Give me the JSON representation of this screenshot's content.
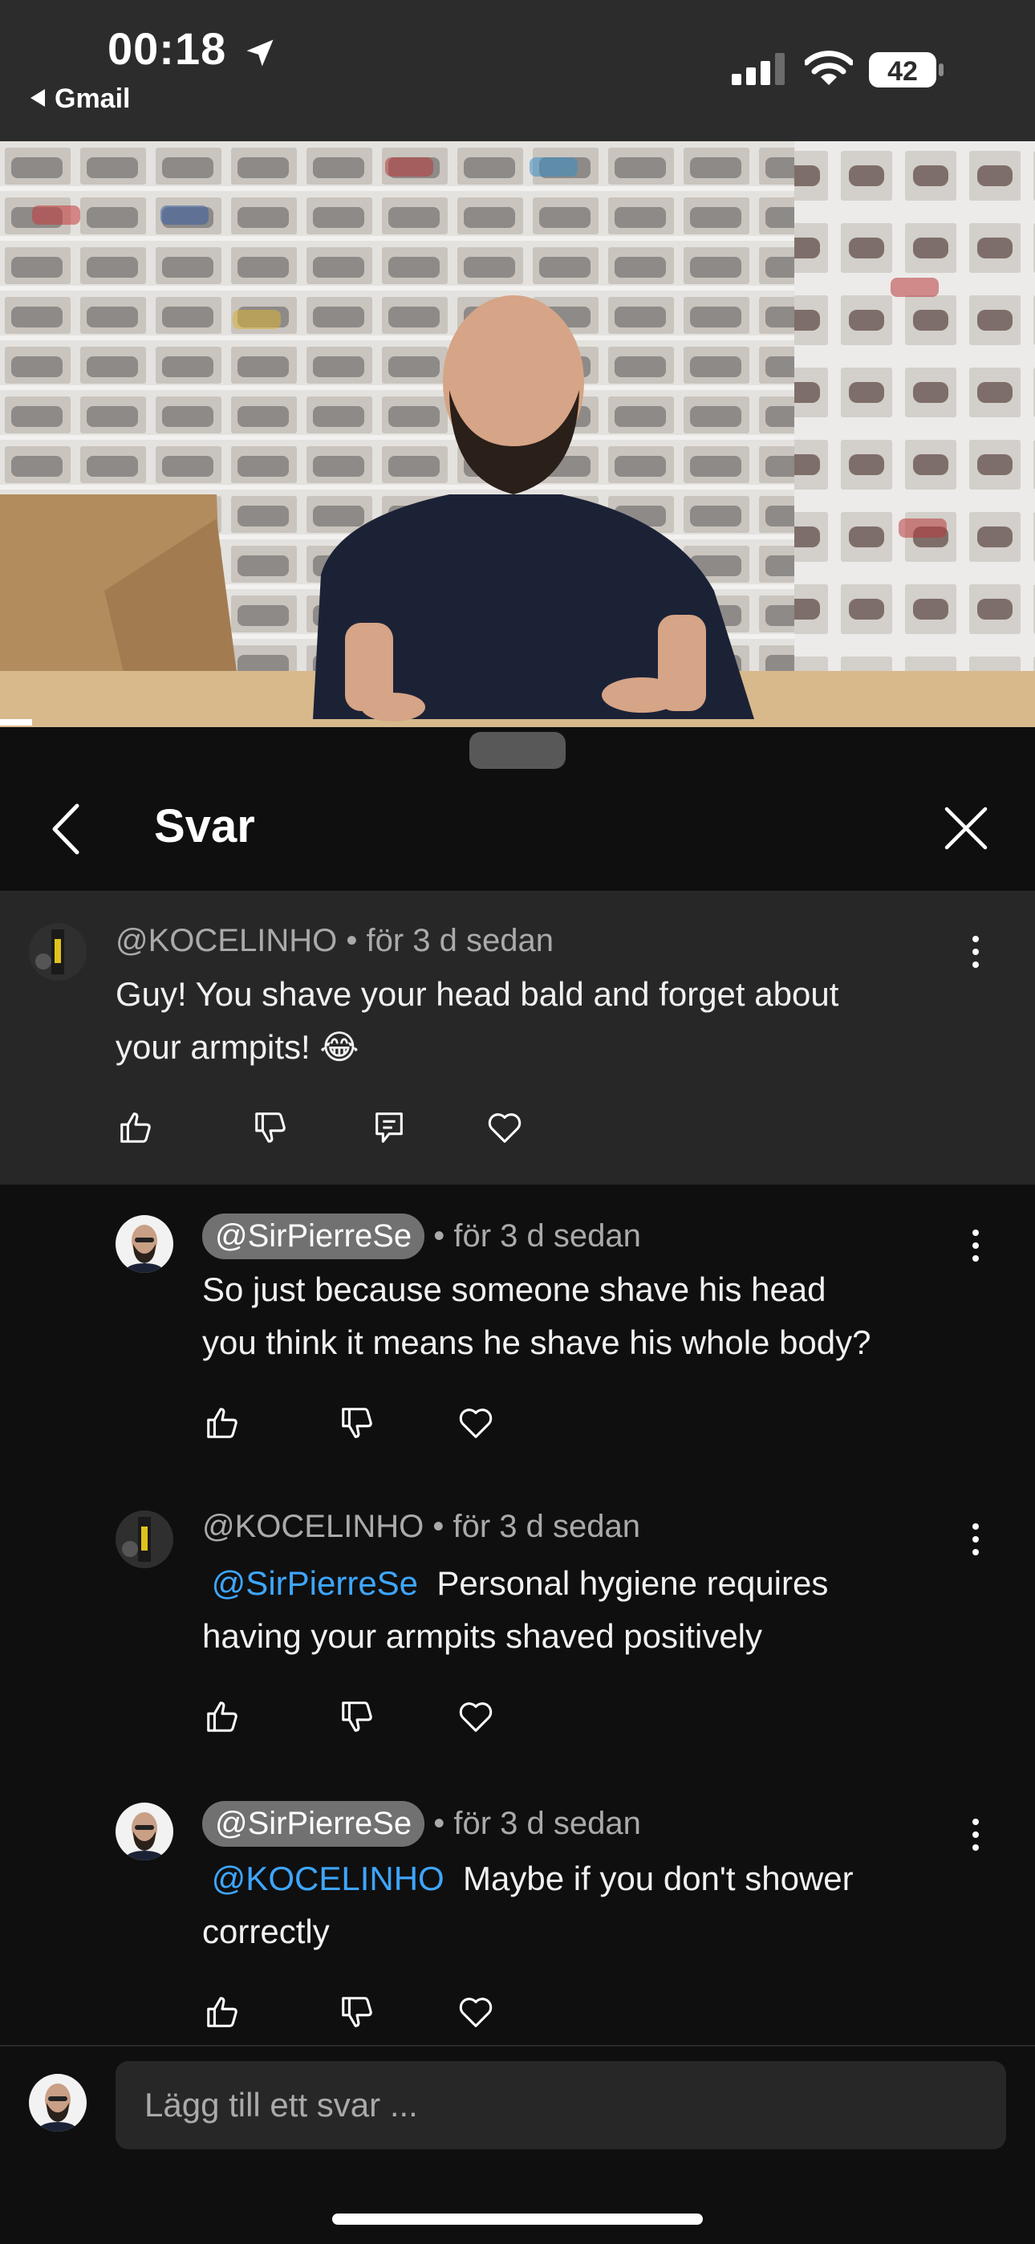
{
  "status": {
    "time": "00:18",
    "back_app": "Gmail",
    "battery": "42"
  },
  "sheet": {
    "title": "Svar",
    "composer_placeholder": "Lägg till ett svar ..."
  },
  "comments": [
    {
      "handle": "@KOCELINHO",
      "age": "• för 3 d sedan",
      "line1": "Guy! You shave your head bald and forget about",
      "line2": "your armpits! 😂",
      "mention": ""
    },
    {
      "handle": "@SirPierreSe",
      "age": "• för 3 d sedan",
      "line1": "So just because someone shave his head",
      "line2": "you think it means he shave his whole body?",
      "mention": ""
    },
    {
      "handle": "@KOCELINHO",
      "age": "• för 3 d sedan",
      "mention": "@SirPierreSe",
      "line1": "Personal hygiene requires",
      "line2": "having your armpits shaved positively"
    },
    {
      "handle": "@SirPierreSe",
      "age": "• för 3 d sedan",
      "mention": "@KOCELINHO",
      "line1": "Maybe if you don't shower",
      "line2": "correctly"
    }
  ],
  "icons": [
    "location-arrow-icon",
    "signal-icon",
    "wifi-icon",
    "battery-icon",
    "back-chevron-icon",
    "close-icon",
    "more-vert-icon",
    "like-icon",
    "dislike-icon",
    "reply-icon",
    "heart-icon"
  ]
}
